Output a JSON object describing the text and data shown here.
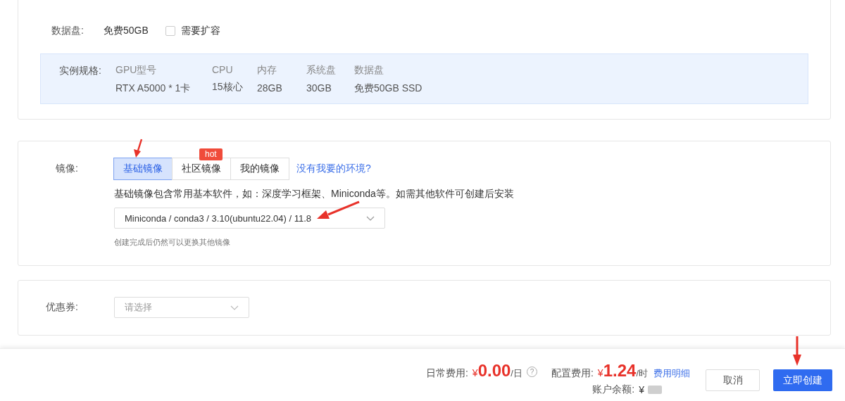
{
  "data_disk": {
    "label": "数据盘:",
    "value": "免费50GB",
    "expand": {
      "label": "需要扩容",
      "checked": false
    }
  },
  "spec": {
    "label": "实例规格:",
    "columns": [
      {
        "head": "GPU型号",
        "value": "RTX A5000 * 1卡"
      },
      {
        "head": "CPU",
        "value": "15核心"
      },
      {
        "head": "内存",
        "value": "28GB"
      },
      {
        "head": "系统盘",
        "value": "30GB"
      },
      {
        "head": "数据盘",
        "value": "免费50GB SSD"
      }
    ]
  },
  "image": {
    "label": "镜像:",
    "tabs": [
      {
        "label": "基础镜像",
        "selected": true
      },
      {
        "label": "社区镜像",
        "selected": false,
        "badge": "hot"
      },
      {
        "label": "我的镜像",
        "selected": false
      }
    ],
    "link": "没有我要的环境?",
    "description": "基础镜像包含常用基本软件，如：深度学习框架、Miniconda等。如需其他软件可创建后安装",
    "select_value": "Miniconda / conda3 / 3.10(ubuntu22.04) / 11.8",
    "note": "创建完成后仍然可以更换其他镜像"
  },
  "coupon": {
    "label": "优惠券:",
    "placeholder": "请选择"
  },
  "footer": {
    "daily_label": "日常费用:",
    "daily_currency": "¥",
    "daily_amount": "0.00",
    "daily_unit": "/日",
    "help": "?",
    "config_label": "配置费用:",
    "config_currency": "¥",
    "config_amount": "1.24",
    "config_unit": "/时",
    "details_link": "费用明细",
    "balance_label": "账户余额:",
    "balance_currency": "¥",
    "cancel": "取消",
    "create": "立即创建"
  }
}
